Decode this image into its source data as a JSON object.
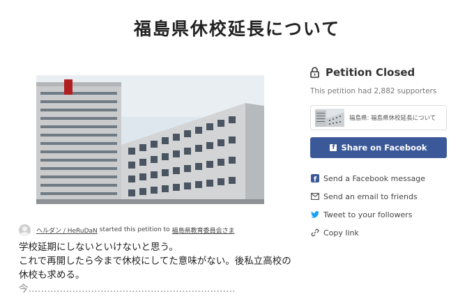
{
  "page": {
    "title": "福島県休校延長について"
  },
  "hero": {
    "icon": "building-photo"
  },
  "starter": {
    "user_name": "ヘルダン / HeRuDaN",
    "action_text": "started this petition to",
    "target": "福島県教育委員会さま"
  },
  "body": {
    "lines": [
      "学校延期にしないといけないと思う。",
      "これで再開したら今まで休校にしてた意味がない。後私立高校の",
      "休校も求める。",
      "今…………………………………………………………"
    ]
  },
  "sidebar": {
    "status": "Petition Closed",
    "supporters_text": "This petition had 2,882 supporters",
    "share_card_text": "福島県: 福島県休校延長について",
    "facebook_button": "Share on Facebook",
    "links": [
      {
        "label": "Send a Facebook message",
        "icon": "messenger-icon"
      },
      {
        "label": "Send an email to friends",
        "icon": "email-icon"
      },
      {
        "label": "Tweet to your followers",
        "icon": "twitter-icon"
      },
      {
        "label": "Copy link",
        "icon": "link-icon"
      }
    ]
  },
  "colors": {
    "facebook": "#3b5998",
    "twitter": "#1da1f2"
  }
}
